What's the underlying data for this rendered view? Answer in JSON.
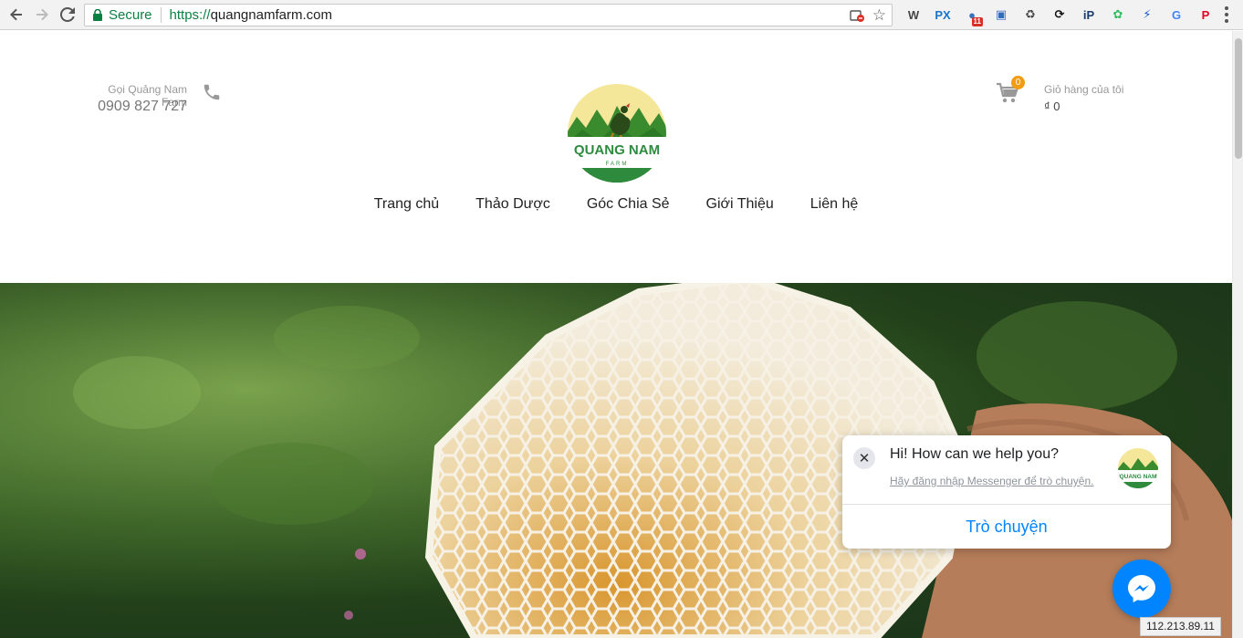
{
  "browser": {
    "secure_label": "Secure",
    "url_proto": "https://",
    "url_host": "quangnamfarm.com",
    "extensions": [
      {
        "name": "wordpress-icon",
        "glyph": "W",
        "color": "#464646"
      },
      {
        "name": "px-icon",
        "glyph": "PX",
        "color": "#1a73c7"
      },
      {
        "name": "globe-extension-icon",
        "glyph": "●",
        "color": "#3b6fbf",
        "badge": "11"
      },
      {
        "name": "calendar-extension-icon",
        "glyph": "▣",
        "color": "#2f6dc1"
      },
      {
        "name": "recycle-icon",
        "glyph": "♻",
        "color": "#444"
      },
      {
        "name": "sync-icon",
        "glyph": "⟳",
        "color": "#111"
      },
      {
        "name": "ip-icon",
        "glyph": "iP",
        "color": "#1a3b6b"
      },
      {
        "name": "evernote-icon",
        "glyph": "✿",
        "color": "#2dbe60"
      },
      {
        "name": "bolt-icon",
        "glyph": "⚡",
        "color": "#1a56c9"
      },
      {
        "name": "translate-icon",
        "glyph": "G",
        "color": "#4285f4"
      },
      {
        "name": "pinterest-icon",
        "glyph": "P",
        "color": "#e60023"
      }
    ]
  },
  "header": {
    "call_label": "Gọi Quảng Nam Farm",
    "phone": "0909 827 727",
    "logo_title": "QUANG NAM",
    "logo_sub": "FARM",
    "cart_count": "0",
    "cart_label": "Giỏ hàng của tôi",
    "cart_total": "₫ 0"
  },
  "nav": {
    "items": [
      "Trang chủ",
      "Thảo Dược",
      "Góc Chia Sẻ",
      "Giới Thiệu",
      "Liên hệ"
    ]
  },
  "messenger": {
    "greeting": "Hi! How can we help you?",
    "login_hint": "Hãy đăng nhập Messenger để trò chuyện.",
    "chat_button": "Trò chuyện"
  },
  "status": {
    "ip": "112.213.89.11"
  },
  "colors": {
    "accent_green": "#2e8b3e",
    "messenger_blue": "#0084ff",
    "cart_badge": "#f39c12"
  }
}
